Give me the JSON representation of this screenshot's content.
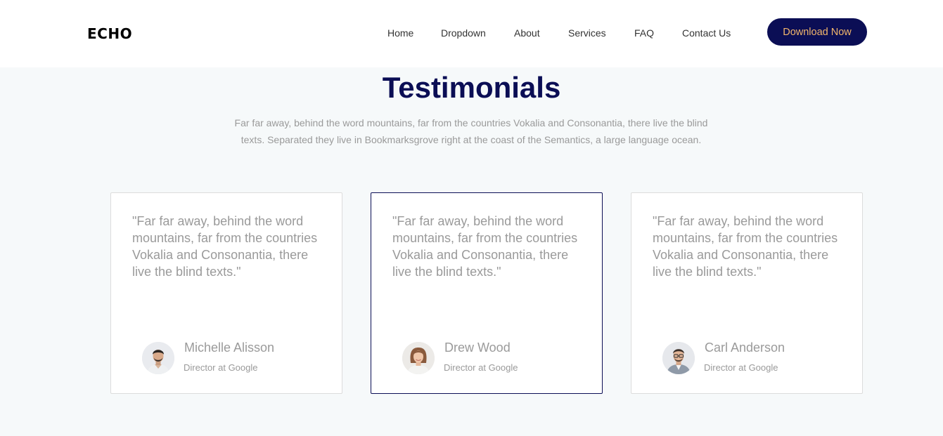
{
  "brand": {
    "logo": "ECHO"
  },
  "nav": {
    "items": [
      "Home",
      "Dropdown",
      "About",
      "Services",
      "FAQ",
      "Contact Us"
    ],
    "cta_label": "Download Now"
  },
  "colors": {
    "primary": "#0b0e55",
    "accent": "#f2b66b",
    "muted_text": "#9a9a9a",
    "background": "#f6f9fa"
  },
  "testimonials": {
    "title": "Testimonials",
    "subtitle": "Far far away, behind the word mountains, far from the countries Vokalia and Consonantia, there live the blind texts. Separated they live in Bookmarksgrove right at the coast of the Semantics, a large language ocean.",
    "cards": [
      {
        "quote": "\"Far far away, behind the word mountains, far from the countries Vokalia and Consonantia, there live the blind texts.\"",
        "name": "Michelle Alisson",
        "role": "Director at Google",
        "avatar_icon": "person-avatar-icon"
      },
      {
        "quote": "\"Far far away, behind the word mountains, far from the countries Vokalia and Consonantia, there live the blind texts.\"",
        "name": "Drew Wood",
        "role": "Director at Google",
        "avatar_icon": "person-avatar-icon"
      },
      {
        "quote": "\"Far far away, behind the word mountains, far from the countries Vokalia and Consonantia, there live the blind texts.\"",
        "name": "Carl Anderson",
        "role": "Director at Google",
        "avatar_icon": "person-avatar-icon"
      }
    ]
  }
}
